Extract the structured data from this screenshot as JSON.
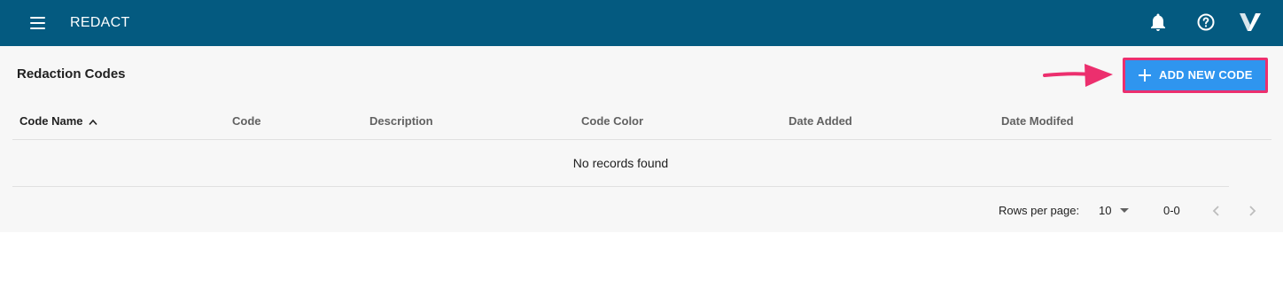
{
  "app": {
    "title": "REDACT",
    "colors": {
      "appbar": "#045a80",
      "accent_button": "#2f95ef",
      "highlight": "#ec2f6e"
    },
    "icons": [
      "menu-icon",
      "notification-bell-icon",
      "help-icon",
      "app-logo-icon"
    ]
  },
  "page": {
    "title": "Redaction Codes",
    "add_button_label": "ADD NEW CODE"
  },
  "table": {
    "columns": [
      {
        "label": "Code Name",
        "sorted": "asc"
      },
      {
        "label": "Code"
      },
      {
        "label": "Description"
      },
      {
        "label": "Code Color"
      },
      {
        "label": "Date Added"
      },
      {
        "label": "Date Modifed"
      }
    ],
    "rows": [],
    "empty_message": "No records found"
  },
  "pagination": {
    "rows_per_page_label": "Rows per page:",
    "rows_per_page_value": "10",
    "range_text": "0-0"
  }
}
